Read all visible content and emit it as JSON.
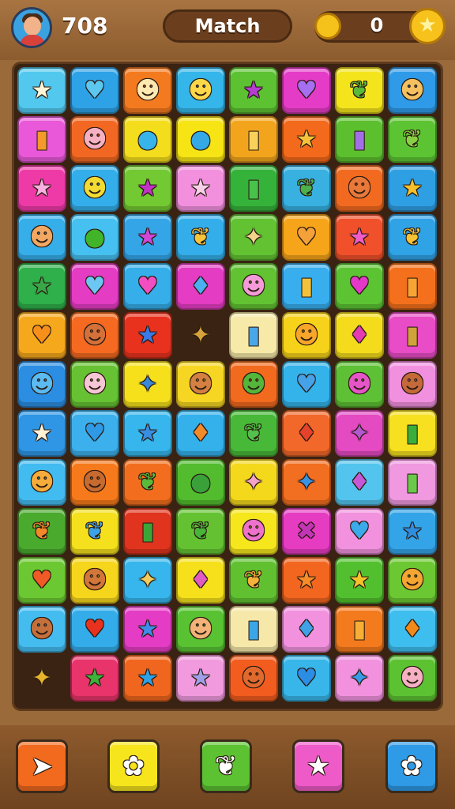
{
  "hud": {
    "score": "708",
    "title": "Match",
    "coins": "0"
  },
  "icons": {
    "avatar": "avatar-icon",
    "coin": "coin-icon",
    "badge": "star-badge-icon"
  },
  "board": {
    "rows": [
      [
        [
          "#52c8ef",
          "star",
          "#fff6d8"
        ],
        [
          "#2ea2e6",
          "heart",
          "#5cc8f0"
        ],
        [
          "#f47a20",
          "face",
          "#ffe9b0"
        ],
        [
          "#34b6ea",
          "face",
          "#ffd84a"
        ],
        [
          "#5cc232",
          "star",
          "#b43cd0"
        ],
        [
          "#e43cc6",
          "heart",
          "#a66ef0"
        ],
        [
          "#f4e41c",
          "leaf",
          "#5ab83a"
        ],
        [
          "#2f9ae8",
          "face",
          "#f5c060"
        ]
      ],
      [
        [
          "#e858d8",
          "bag",
          "#f39a2a"
        ],
        [
          "#f26822",
          "face",
          "#f6b0c4"
        ],
        [
          "#f4dd1c",
          "blob",
          "#38b4ea"
        ],
        [
          "#f7e414",
          "blob",
          "#34a9e6"
        ],
        [
          "#f2a51c",
          "bag",
          "#f7d15a"
        ],
        [
          "#f36a1c",
          "star",
          "#f6c23a"
        ],
        [
          "#5cbf2e",
          "bag",
          "#a46ee8"
        ],
        [
          "#5cc432",
          "leaf",
          "#8ad044"
        ]
      ],
      [
        [
          "#ee3aa6",
          "star",
          "#f8b2e2"
        ],
        [
          "#34aeea",
          "face",
          "#f2dc32"
        ],
        [
          "#73c932",
          "star",
          "#c232c4"
        ],
        [
          "#f290de",
          "star",
          "#f8d0e8"
        ],
        [
          "#35b23a",
          "bag",
          "#48c24a"
        ],
        [
          "#38b0e0",
          "leaf",
          "#4db04a"
        ],
        [
          "#f26a1f",
          "face",
          "#e8793a"
        ],
        [
          "#2f9fe4",
          "star",
          "#f6c02a"
        ]
      ],
      [
        [
          "#35aeea",
          "face",
          "#f2a862"
        ],
        [
          "#46c0f0",
          "blob",
          "#42b42a"
        ],
        [
          "#34a6e8",
          "star",
          "#d046d6"
        ],
        [
          "#34aeea",
          "leaf",
          "#f7c43a"
        ],
        [
          "#62c232",
          "pin",
          "#f4d48a"
        ],
        [
          "#f6a41a",
          "heart",
          "#f5a13a"
        ],
        [
          "#f0502a",
          "star",
          "#f05cc8"
        ],
        [
          "#30a2e6",
          "leaf",
          "#f6c234"
        ]
      ],
      [
        [
          "#2fb04a",
          "star",
          "#3aa648"
        ],
        [
          "#e43cc2",
          "heart",
          "#6cc8f2"
        ],
        [
          "#35aeea",
          "heart",
          "#f24ec2"
        ],
        [
          "#e43cc2",
          "drop",
          "#4ab0f0"
        ],
        [
          "#62c232",
          "face",
          "#f59ad8"
        ],
        [
          "#38aeee",
          "bag",
          "#f4c23a"
        ],
        [
          "#5cc432",
          "heart",
          "#e438c8"
        ],
        [
          "#f4701c",
          "bag",
          "#f7a434"
        ]
      ],
      [
        [
          "#f6a81c",
          "heart",
          "#f7901a"
        ],
        [
          "#f56a20",
          "face",
          "#d4703a"
        ],
        [
          "#e8321e",
          "star",
          "#3a7ae6"
        ],
        [
          "#3a2312",
          "pin",
          "#d6a23a"
        ],
        [
          "#f7eaa8",
          "bag",
          "#4aa6e6"
        ],
        [
          "#f6d21a",
          "face",
          "#f7a62a"
        ],
        [
          "#f4dc1c",
          "drop",
          "#e43ab2"
        ],
        [
          "#e84cc6",
          "bag",
          "#d0a23a"
        ]
      ],
      [
        [
          "#2b8ee2",
          "face",
          "#5bbaf0"
        ],
        [
          "#66c232",
          "face",
          "#f7c6d6"
        ],
        [
          "#f6e01c",
          "pin",
          "#3a88d8"
        ],
        [
          "#f6d622",
          "face",
          "#d48042"
        ],
        [
          "#f26a1e",
          "face",
          "#54b63a"
        ],
        [
          "#34b2ea",
          "heart",
          "#46a2e8"
        ],
        [
          "#5ec034",
          "face",
          "#e655c8"
        ],
        [
          "#f290e0",
          "face",
          "#c46a3a"
        ]
      ],
      [
        [
          "#2e96e4",
          "star",
          "#fff2d6"
        ],
        [
          "#3cb0ec",
          "heart",
          "#2e9ae6"
        ],
        [
          "#36b6ec",
          "star",
          "#3a8ee2"
        ],
        [
          "#34b0ea",
          "drop",
          "#f28a2a"
        ],
        [
          "#48b838",
          "leaf",
          "#52c04a"
        ],
        [
          "#f2682a",
          "drop",
          "#e4422a"
        ],
        [
          "#e44ac2",
          "pin",
          "#b458d0"
        ],
        [
          "#f6e020",
          "bag",
          "#3aae3a"
        ]
      ],
      [
        [
          "#42bcf0",
          "face",
          "#f6ac3a"
        ],
        [
          "#f67a1c",
          "face",
          "#c76a30"
        ],
        [
          "#f26e1e",
          "leaf",
          "#5cba3a"
        ],
        [
          "#52bc2e",
          "blob",
          "#3aa03a"
        ],
        [
          "#f4d81c",
          "pin",
          "#f4a2c8"
        ],
        [
          "#f26e20",
          "pin",
          "#3a92e2"
        ],
        [
          "#52c4ee",
          "drop",
          "#c658d6"
        ],
        [
          "#f098e0",
          "bag",
          "#6ac84a"
        ]
      ],
      [
        [
          "#4aaa2e",
          "leaf",
          "#f4882a"
        ],
        [
          "#f4e01c",
          "leaf",
          "#3ea2e6"
        ],
        [
          "#e0341e",
          "bag",
          "#3aa63a"
        ],
        [
          "#64c232",
          "leaf",
          "#48b43a"
        ],
        [
          "#f6e61c",
          "face",
          "#ee72cc"
        ],
        [
          "#e63cc2",
          "cross",
          "#c236b6"
        ],
        [
          "#f292de",
          "heart",
          "#3caaea"
        ],
        [
          "#34a4e8",
          "star",
          "#2e8ee0"
        ]
      ],
      [
        [
          "#6cc832",
          "heart",
          "#f05a26"
        ],
        [
          "#f6d61c",
          "face",
          "#d2763a"
        ],
        [
          "#36b6ec",
          "pin",
          "#f4cc5a"
        ],
        [
          "#f6e01c",
          "drop",
          "#e05ac2"
        ],
        [
          "#60c030",
          "leaf",
          "#f5b23a"
        ],
        [
          "#f26620",
          "star",
          "#f78c28"
        ],
        [
          "#52c02e",
          "star",
          "#f6c22a"
        ],
        [
          "#6cc832",
          "face",
          "#f4a632"
        ]
      ],
      [
        [
          "#44bcf0",
          "face",
          "#c5703c"
        ],
        [
          "#34acea",
          "heart",
          "#e8321e"
        ],
        [
          "#e43cc4",
          "star",
          "#3e8ee8"
        ],
        [
          "#58c232",
          "face",
          "#f2b278"
        ],
        [
          "#f6e8a8",
          "bag",
          "#3aa6e8"
        ],
        [
          "#f292de",
          "drop",
          "#40a2e6"
        ],
        [
          "#f47a1e",
          "bag",
          "#f7ae34"
        ],
        [
          "#3ebeee",
          "drop",
          "#f28a1a"
        ]
      ],
      [
        [
          "#3a2312",
          "pin",
          "#e8b22a"
        ],
        [
          "#e8346a",
          "star",
          "#3cb43a"
        ],
        [
          "#f0661e",
          "star",
          "#2ea2e6"
        ],
        [
          "#f29ade",
          "star",
          "#a0a0e8"
        ],
        [
          "#f25c1e",
          "face",
          "#e06a2e"
        ],
        [
          "#38b6ea",
          "heart",
          "#2b8ee4"
        ],
        [
          "#f292de",
          "pin",
          "#3a9ae6"
        ],
        [
          "#5cc232",
          "face",
          "#f6b0c4"
        ]
      ]
    ]
  },
  "bottom_buttons": [
    {
      "name": "pointer-button",
      "bg": "#f26a1e",
      "glyph": "➤"
    },
    {
      "name": "flower-button",
      "bg": "#f6e41c",
      "glyph": "✿"
    },
    {
      "name": "leaf-button",
      "bg": "#5cc232",
      "glyph": "❦"
    },
    {
      "name": "star-button",
      "bg": "#ee5ac8",
      "glyph": "★"
    },
    {
      "name": "settings-button",
      "bg": "#2f9ae6",
      "glyph": "✿"
    }
  ]
}
